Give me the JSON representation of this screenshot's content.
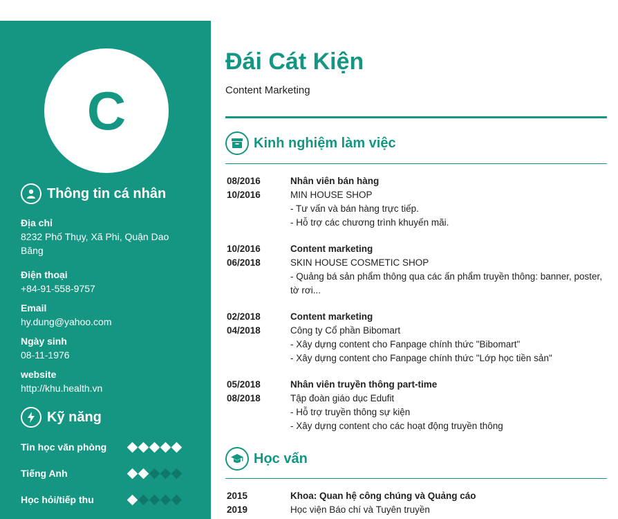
{
  "profile": {
    "initial": "C",
    "name": "Đái Cát Kiện",
    "role": "Content Marketing"
  },
  "personal": {
    "heading": "Thông tin cá nhân",
    "icon": "person-icon",
    "address_label": "Địa chỉ",
    "address": "8232 Phố Thụy, Xã Phi, Quận Dao Băng",
    "phone_label": "Điện thoại",
    "phone": "+84-91-558-9757",
    "email_label": "Email",
    "email": "hy.dung@yahoo.com",
    "birthday_label": "Ngày sinh",
    "birthday": "08-11-1976",
    "website_label": "website",
    "website": "http://khu.health.vn"
  },
  "skills": {
    "heading": "Kỹ năng",
    "icon": "lightning-icon",
    "items": [
      {
        "name": "Tin học văn phòng",
        "level": 5,
        "max": 5
      },
      {
        "name": "Tiếng Anh",
        "level": 2,
        "max": 5
      },
      {
        "name": "Học hỏi/tiếp thu",
        "level": 1,
        "max": 5
      }
    ]
  },
  "experience": {
    "heading": "Kinh nghiệm làm việc",
    "icon": "archive-box-icon",
    "items": [
      {
        "start": "08/2016",
        "end": "10/2016",
        "position": "Nhân viên bán hàng",
        "company": "MIN HOUSE SHOP",
        "details": [
          "- Tư vấn và bán hàng trực tiếp.",
          "- Hỗ trợ các chương trình khuyến mãi."
        ]
      },
      {
        "start": "10/2016",
        "end": "06/2018",
        "position": "Content marketing",
        "company": "SKIN HOUSE COSMETIC SHOP",
        "details": [
          "- Quảng bá sản phẩm thông qua các ấn phẩm truyền thông: banner, poster, tờ rơi..."
        ]
      },
      {
        "start": "02/2018",
        "end": "04/2018",
        "position": "Content marketing",
        "company": "Công ty Cổ phần Bibomart",
        "details": [
          "- Xây dựng content cho Fanpage chính thức \"Bibomart\"",
          "- Xây dựng content cho Fanpage chính thức \"Lớp học tiền sản\""
        ]
      },
      {
        "start": "05/2018",
        "end": "08/2018",
        "position": "Nhân viên truyền thông part-time",
        "company": "Tập đoàn giáo dục Edufit",
        "details": [
          "- Hỗ trợ truyền thông sự kiện",
          "- Xây dựng content cho các hoạt động truyền thông"
        ]
      }
    ]
  },
  "education": {
    "heading": "Học vấn",
    "icon": "graduation-cap-icon",
    "items": [
      {
        "start": "2015",
        "end": "2019",
        "position": "Khoa: Quan hệ công chúng và Quảng cáo",
        "company": "Học viện Báo chí và Tuyên truyền"
      }
    ]
  },
  "colors": {
    "accent": "#149682",
    "dot_off": "#107868"
  }
}
